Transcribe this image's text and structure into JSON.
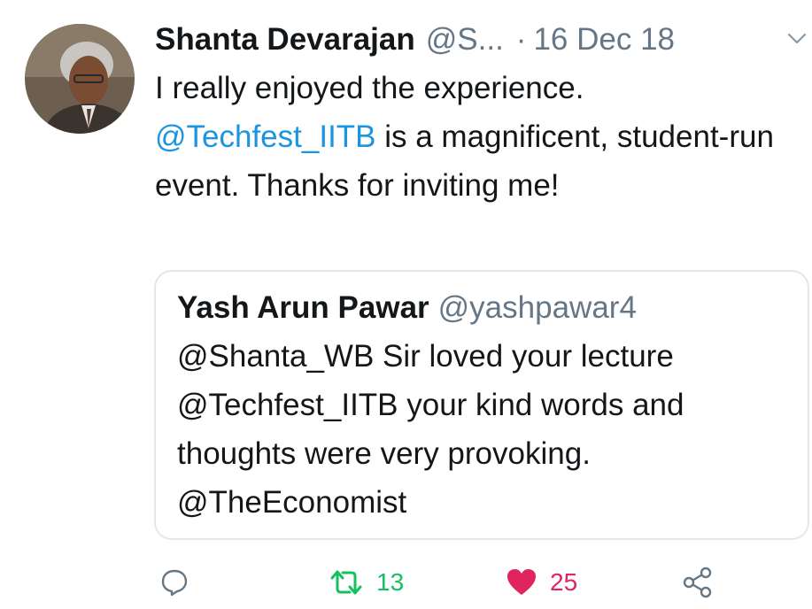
{
  "tweet": {
    "author_name": "Shanta Devarajan",
    "author_handle": "@S...",
    "separator": "·",
    "date": "16 Dec 18",
    "text_line1": "I really enjoyed the experience.",
    "mention": "@Techfest_IITB",
    "text_after_mention": " is a magnificent, student-run event. Thanks for inviting me!"
  },
  "quoted_tweet": {
    "author_name": "Yash Arun Pawar",
    "author_handle": "@yashpawar4",
    "text": "@Shanta_WB Sir loved your lecture @Techfest_IITB your kind words and thoughts were very provoking. @TheEconomist"
  },
  "actions": {
    "reply_icon": "comment-icon",
    "retweet_icon": "retweet-icon",
    "retweet_count": "13",
    "like_icon": "heart-icon",
    "like_count": "25",
    "share_icon": "share-icon"
  },
  "colors": {
    "link": "#1b95e0",
    "muted": "#657786",
    "retweet": "#17bf63",
    "like": "#e0245e",
    "border": "#e1e8ed"
  }
}
